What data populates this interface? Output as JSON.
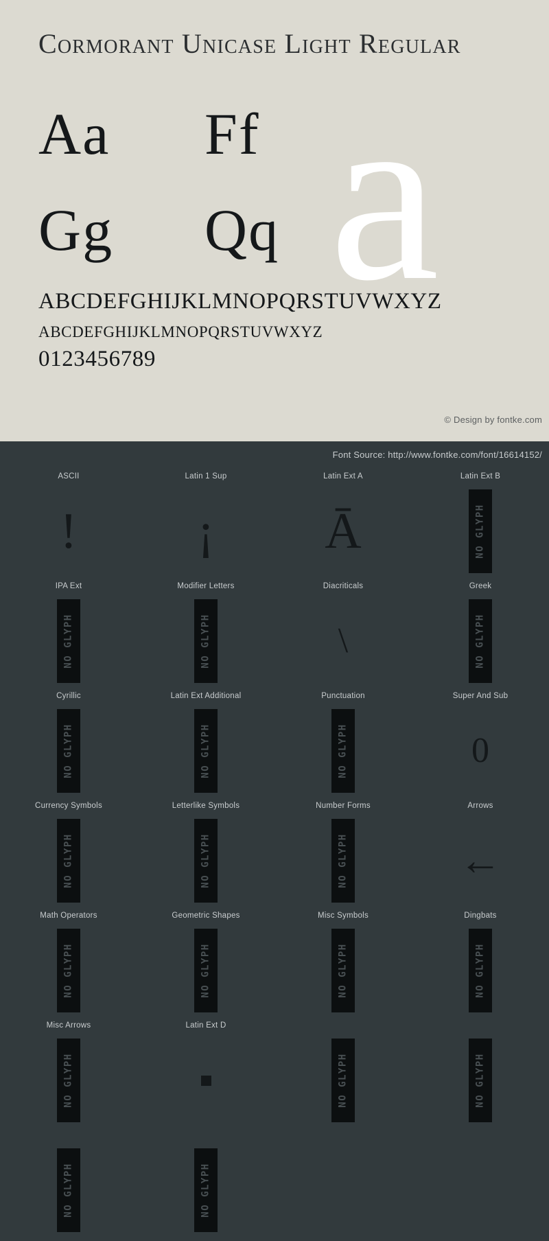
{
  "specimen": {
    "title": "Cormorant Unicase Light Regular",
    "watermark_glyph": "a",
    "glyph_pairs": [
      "Aa",
      "Ff",
      "Gg",
      "Qq"
    ],
    "alphabet_uppercase": "ABCDEFGHIJKLMNOPQRSTUVWXYZ",
    "alphabet_lowercase": "abcdefghijklmnopqrstuvwxyz",
    "digits": "0123456789",
    "copyright": "© Design by fontke.com",
    "background_color": "#dcdad1",
    "text_color": "#15181a"
  },
  "blocks_section": {
    "source": "Font Source: http://www.fontke.com/font/16614152/",
    "background_color": "#323a3d",
    "no_glyph_label": "NO GLYPH",
    "blocks": [
      {
        "label": "ASCII",
        "sample": "!",
        "type": "glyph"
      },
      {
        "label": "Latin 1 Sup",
        "sample": "¡",
        "type": "glyph"
      },
      {
        "label": "Latin Ext A",
        "sample": "Ā",
        "type": "glyph"
      },
      {
        "label": "Latin Ext B",
        "sample": "",
        "type": "no-glyph"
      },
      {
        "label": "IPA Ext",
        "sample": "",
        "type": "no-glyph"
      },
      {
        "label": "Modifier Letters",
        "sample": "",
        "type": "no-glyph"
      },
      {
        "label": "Diacriticals",
        "sample": "\\",
        "type": "glyph-small"
      },
      {
        "label": "Greek",
        "sample": "",
        "type": "no-glyph"
      },
      {
        "label": "Cyrillic",
        "sample": "",
        "type": "no-glyph"
      },
      {
        "label": "Latin Ext Additional",
        "sample": "",
        "type": "no-glyph"
      },
      {
        "label": "Punctuation",
        "sample": "",
        "type": "no-glyph"
      },
      {
        "label": "Super And Sub",
        "sample": "0",
        "type": "glyph-small"
      },
      {
        "label": "Currency Symbols",
        "sample": "",
        "type": "no-glyph"
      },
      {
        "label": "Letterlike Symbols",
        "sample": "",
        "type": "no-glyph"
      },
      {
        "label": "Number Forms",
        "sample": "",
        "type": "no-glyph"
      },
      {
        "label": "Arrows",
        "sample": "←",
        "type": "glyph-arrow"
      },
      {
        "label": "Math Operators",
        "sample": "",
        "type": "no-glyph"
      },
      {
        "label": "Geometric Shapes",
        "sample": "",
        "type": "no-glyph"
      },
      {
        "label": "Misc Symbols",
        "sample": "",
        "type": "no-glyph"
      },
      {
        "label": "Dingbats",
        "sample": "",
        "type": "no-glyph"
      },
      {
        "label": "Misc Arrows",
        "sample": "",
        "type": "no-glyph"
      },
      {
        "label": "Latin Ext D",
        "sample": "",
        "type": "square"
      },
      {
        "label": "",
        "sample": "",
        "type": "no-glyph"
      },
      {
        "label": "",
        "sample": "",
        "type": "no-glyph"
      },
      {
        "label": "",
        "sample": "",
        "type": "no-glyph"
      },
      {
        "label": "",
        "sample": "",
        "type": "no-glyph"
      }
    ]
  }
}
